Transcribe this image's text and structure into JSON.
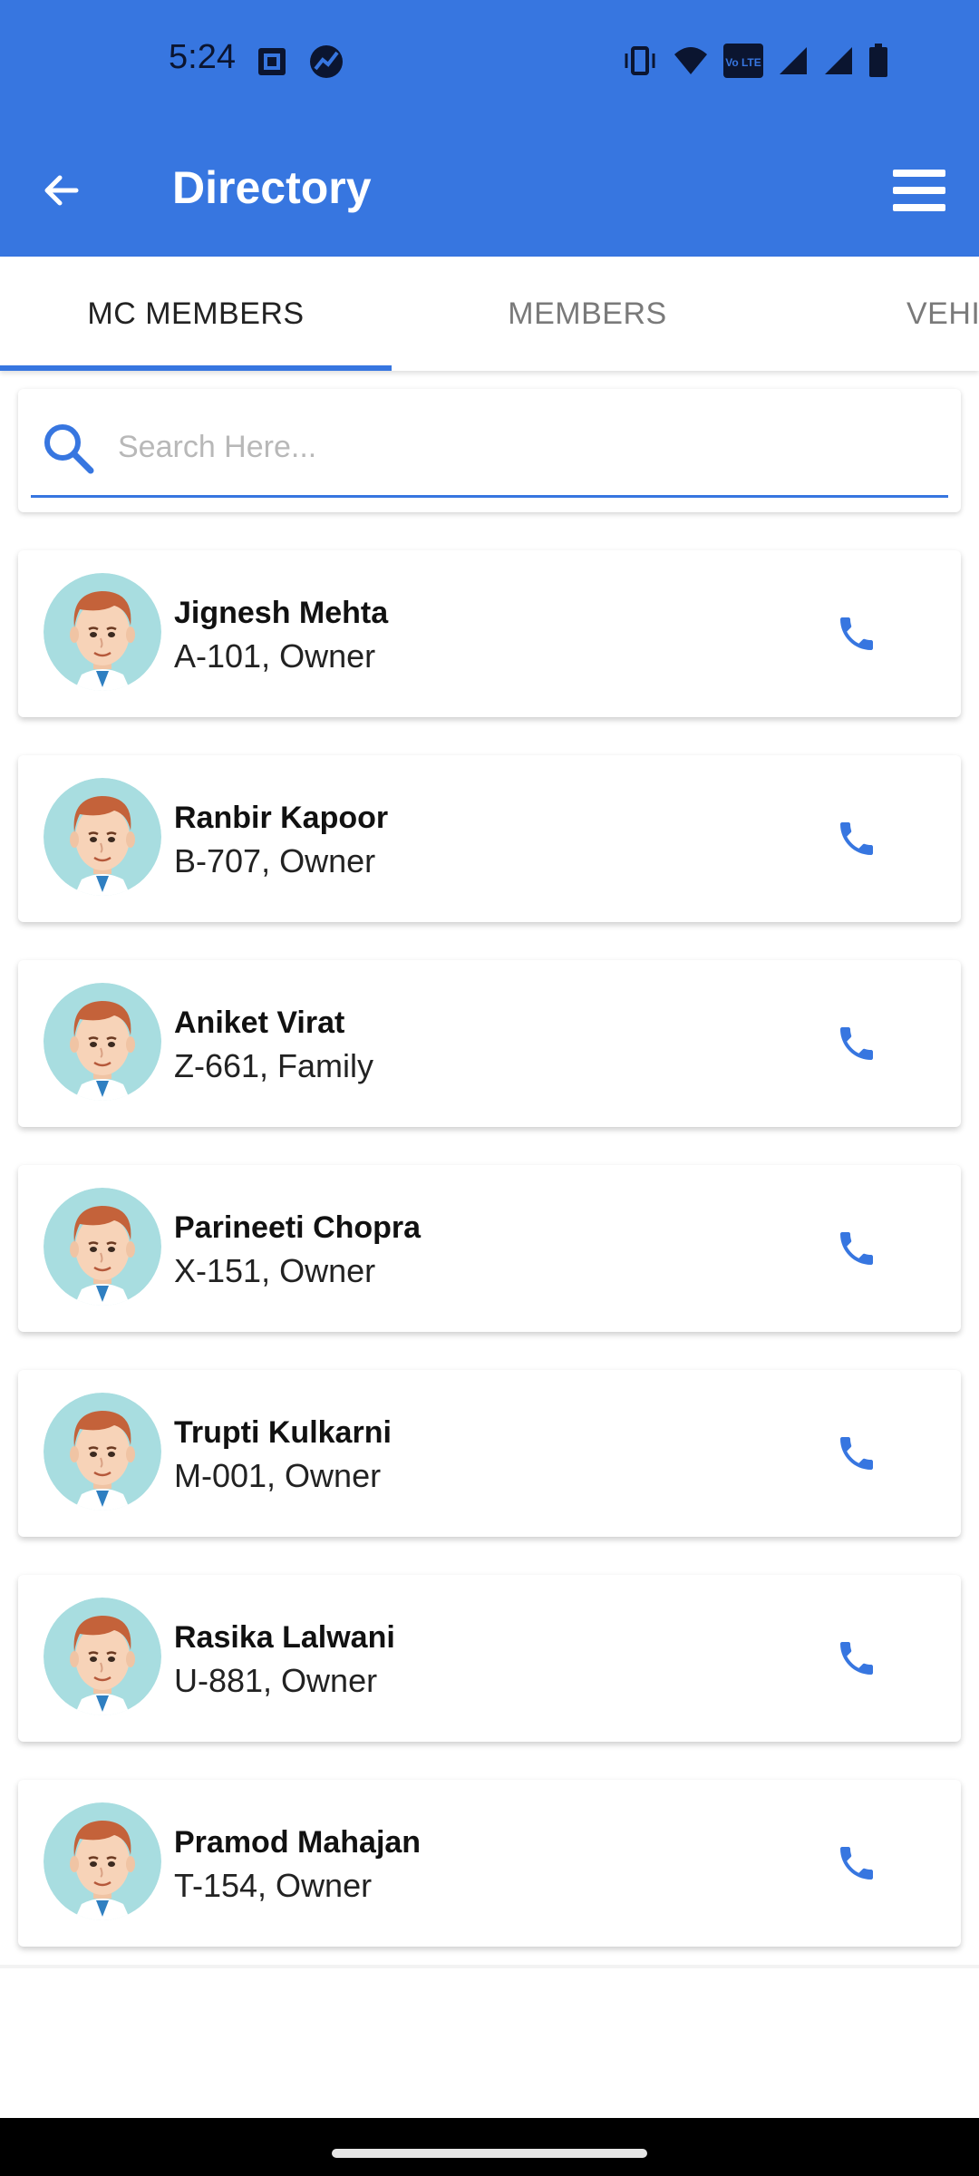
{
  "status_bar": {
    "time": "5:24",
    "left_icons": [
      "screenshot-icon",
      "app-notification-icon"
    ],
    "right_icons": [
      "vibrate-icon",
      "wifi-icon",
      "volte-icon",
      "signal-icon",
      "signal-icon",
      "battery-icon"
    ],
    "volte_text": "Vo LTE"
  },
  "header": {
    "title": "Directory",
    "back_icon": "arrow-back-icon",
    "menu_icon": "hamburger-menu-icon",
    "color": "#3776e0"
  },
  "tabs": [
    {
      "label": "MC MEMBERS",
      "active": true
    },
    {
      "label": "MEMBERS",
      "active": false
    },
    {
      "label": "VEHI",
      "active": false
    }
  ],
  "search": {
    "placeholder": "Search Here...",
    "value": ""
  },
  "members": [
    {
      "name": "Jignesh Mehta",
      "unit": "A-101, Owner"
    },
    {
      "name": "Ranbir Kapoor",
      "unit": "B-707, Owner"
    },
    {
      "name": "Aniket Virat",
      "unit": "Z-661, Family"
    },
    {
      "name": "Parineeti Chopra",
      "unit": "X-151, Owner"
    },
    {
      "name": "Trupti Kulkarni",
      "unit": "M-001, Owner"
    },
    {
      "name": "Rasika Lalwani",
      "unit": "U-881, Owner"
    },
    {
      "name": "Pramod Mahajan",
      "unit": "T-154, Owner"
    }
  ],
  "colors": {
    "accent": "#3776e0",
    "avatar_bg": "#a8dde0",
    "avatar_hair": "#c4623a",
    "avatar_skin": "#f7d3b8"
  }
}
